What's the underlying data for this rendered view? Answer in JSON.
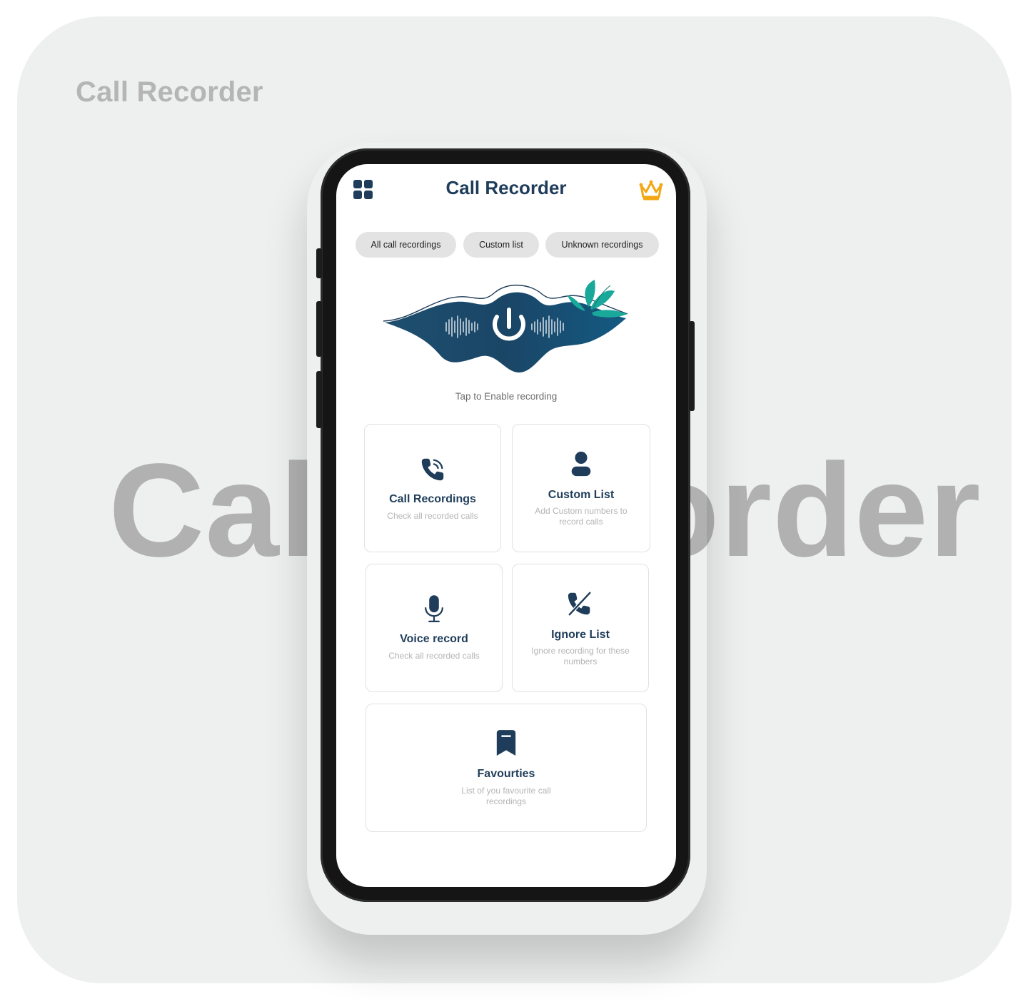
{
  "background": {
    "corner_title": "Call Recorder",
    "big_title": "Call Recorder"
  },
  "header": {
    "title": "Call Recorder",
    "menu_icon": "grid-icon",
    "premium_icon": "crown-icon"
  },
  "tabs": [
    {
      "label": "All call recordings"
    },
    {
      "label": "Custom list"
    },
    {
      "label": "Unknown recordings"
    }
  ],
  "record_toggle": {
    "icon": "power-icon",
    "hint": "Tap to Enable recording"
  },
  "cards": [
    {
      "icon": "phone-ringing-icon",
      "title": "Call Recordings",
      "desc": "Check all recorded calls"
    },
    {
      "icon": "user-icon",
      "title": "Custom List",
      "desc": "Add Custom numbers to record calls"
    },
    {
      "icon": "microphone-icon",
      "title": "Voice record",
      "desc": "Check all recorded calls"
    },
    {
      "icon": "phone-blocked-icon",
      "title": "Ignore List",
      "desc": "Ignore recording for these numbers"
    },
    {
      "icon": "bookmark-icon",
      "title": "Favourties",
      "desc": "List of you favourite call recordings"
    }
  ],
  "colors": {
    "primary": "#1f3d5a",
    "accent_gold": "#f3a712",
    "leaf_teal": "#1aa89b",
    "background": "#eef0ef"
  }
}
